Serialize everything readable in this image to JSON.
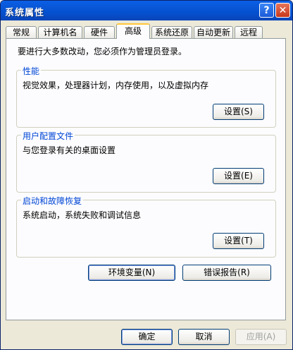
{
  "window": {
    "title": "系统属性"
  },
  "tabs": [
    {
      "label": "常规"
    },
    {
      "label": "计算机名"
    },
    {
      "label": "硬件"
    },
    {
      "label": "高级"
    },
    {
      "label": "系统还原"
    },
    {
      "label": "自动更新"
    },
    {
      "label": "远程"
    }
  ],
  "note": "要进行大多数改动，您必须作为管理员登录。",
  "performance": {
    "legend": "性能",
    "desc": "视觉效果，处理器计划，内存使用，以及虚拟内存",
    "button": "设置(S)"
  },
  "profiles": {
    "legend": "用户配置文件",
    "desc": "与您登录有关的桌面设置",
    "button": "设置(E)"
  },
  "startup": {
    "legend": "启动和故障恢复",
    "desc": "系统启动，系统失败和调试信息",
    "button": "设置(T)"
  },
  "env_button": "环境变量(N)",
  "error_button": "错误报告(R)",
  "footer": {
    "ok": "确定",
    "cancel": "取消",
    "apply": "应用(A)"
  },
  "icons": {
    "help": "?",
    "close": "✕"
  }
}
